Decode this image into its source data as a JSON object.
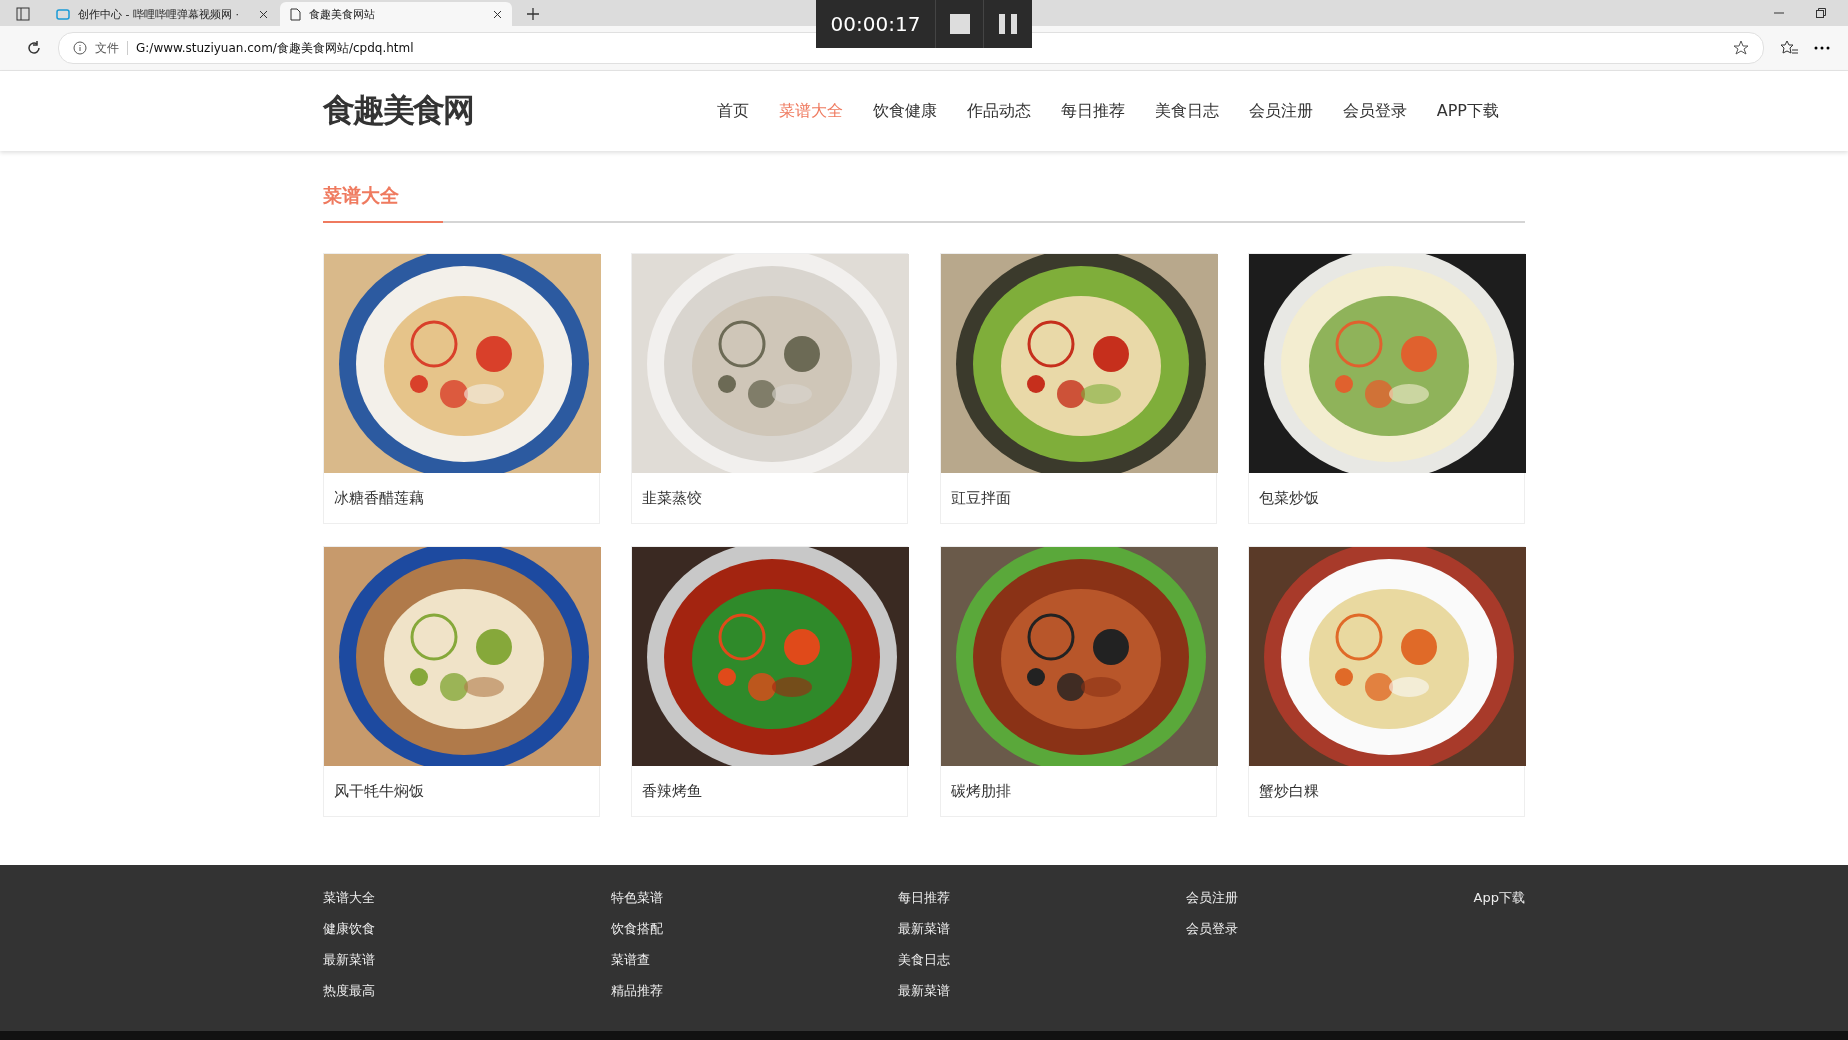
{
  "browser": {
    "tabs": [
      {
        "title": "创作中心 - 哔哩哔哩弹幕视频网 ·",
        "selected": false,
        "kind": "video"
      },
      {
        "title": "食趣美食网站",
        "selected": true,
        "kind": "page"
      }
    ],
    "recorder": {
      "time": "00:00:17"
    },
    "address": {
      "info_label": "文件",
      "url": "G:/www.stuziyuan.com/食趣美食网站/cpdq.html"
    }
  },
  "nav": {
    "logo": "食趣美食网",
    "items": [
      {
        "label": "首页",
        "selected": false
      },
      {
        "label": "菜谱大全",
        "selected": true
      },
      {
        "label": "饮食健康",
        "selected": false
      },
      {
        "label": "作品动态",
        "selected": false
      },
      {
        "label": "每日推荐",
        "selected": false
      },
      {
        "label": "美食日志",
        "selected": false
      },
      {
        "label": "会员注册",
        "selected": false
      },
      {
        "label": "会员登录",
        "selected": false
      },
      {
        "label": "APP下载",
        "selected": false
      }
    ]
  },
  "section_title": "菜谱大全",
  "recipes": [
    {
      "name": "冰糖香醋莲藕",
      "kind": "picture"
    },
    {
      "name": "韭菜蒸饺",
      "kind": "picture"
    },
    {
      "name": "豇豆拌面",
      "kind": "picture"
    },
    {
      "name": "包菜炒饭",
      "kind": "picture"
    },
    {
      "name": "风干牦牛焖饭",
      "kind": "picture"
    },
    {
      "name": "香辣烤鱼",
      "kind": "picture"
    },
    {
      "name": "碳烤肋排",
      "kind": "picture"
    },
    {
      "name": "蟹炒白粿",
      "kind": "picture"
    }
  ],
  "footer": {
    "columns": [
      [
        "菜谱大全",
        "健康饮食",
        "最新菜谱",
        "热度最高"
      ],
      [
        "特色菜谱",
        "饮食搭配",
        "菜谱查",
        "精品推荐"
      ],
      [
        "每日推荐",
        "最新菜谱",
        "美食日志",
        "最新菜谱"
      ],
      [
        "会员注册",
        "会员登录"
      ],
      [
        "App下载"
      ]
    ]
  }
}
